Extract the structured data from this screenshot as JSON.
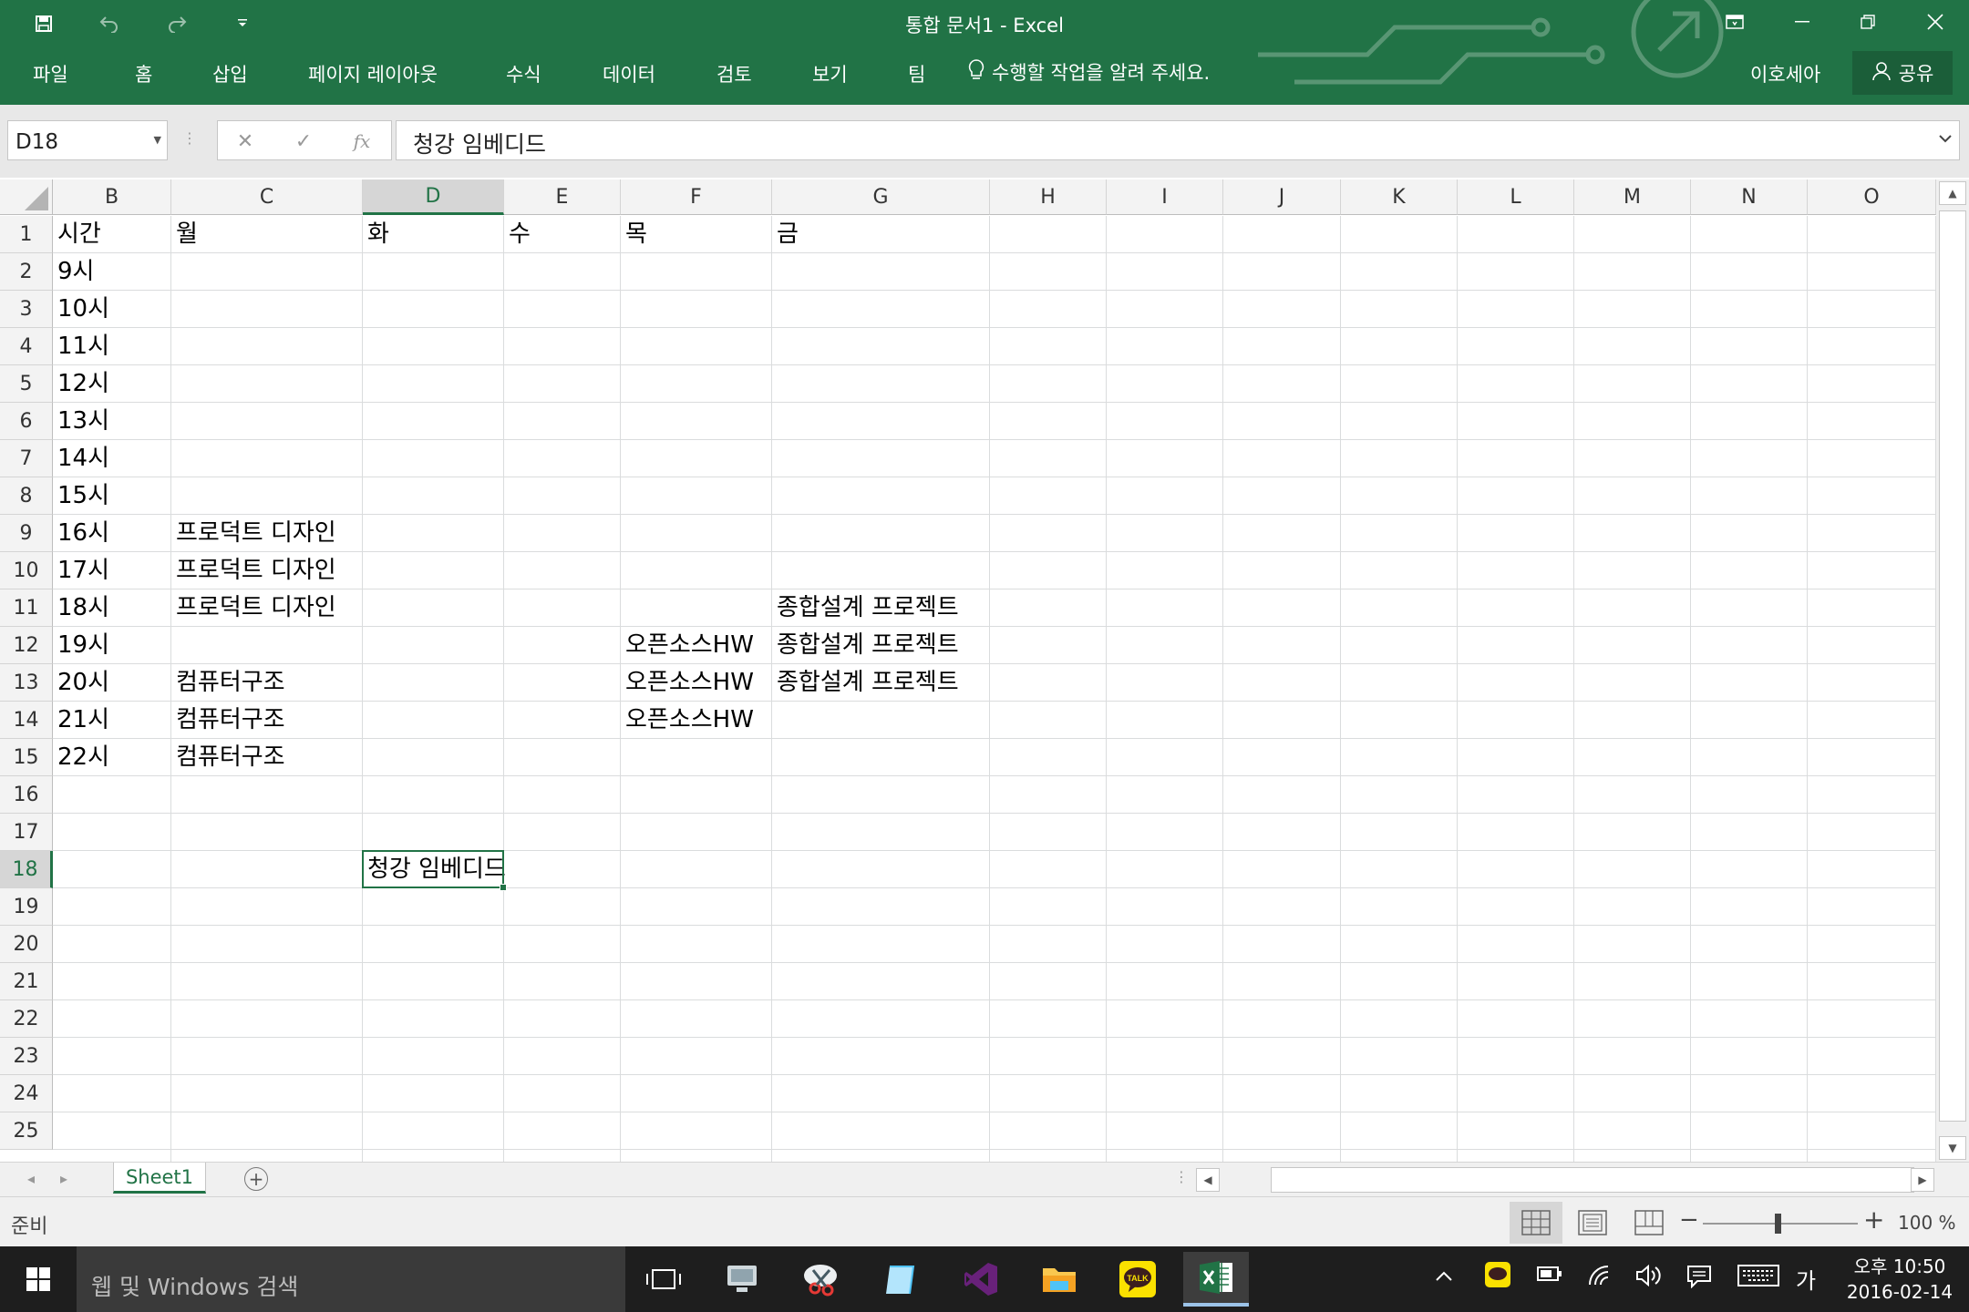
{
  "window": {
    "title": "통합 문서1 - Excel",
    "user_name": "이호세아",
    "share_label": "공유"
  },
  "ribbon": {
    "tabs": [
      "파일",
      "홈",
      "삽입",
      "페이지 레이아웃",
      "수식",
      "데이터",
      "검토",
      "보기",
      "팀"
    ],
    "tell_me": "수행할 작업을 알려 주세요."
  },
  "formula_bar": {
    "name_box": "D18",
    "fx_label": "fx",
    "content": "청강 임베디드"
  },
  "sheet": {
    "columns": [
      "B",
      "C",
      "D",
      "E",
      "F",
      "G",
      "H",
      "I",
      "J",
      "K",
      "L",
      "M",
      "N",
      "O"
    ],
    "active_column": "D",
    "rows": [
      "1",
      "2",
      "3",
      "4",
      "5",
      "6",
      "7",
      "8",
      "9",
      "10",
      "11",
      "12",
      "13",
      "14",
      "15",
      "16",
      "17",
      "18",
      "19",
      "20",
      "21",
      "22",
      "23",
      "24",
      "25"
    ],
    "active_row": "18",
    "cells": [
      {
        "ref": "B1",
        "value": "시간"
      },
      {
        "ref": "C1",
        "value": "월"
      },
      {
        "ref": "D1",
        "value": "화"
      },
      {
        "ref": "E1",
        "value": "수"
      },
      {
        "ref": "F1",
        "value": "목"
      },
      {
        "ref": "G1",
        "value": "금"
      },
      {
        "ref": "B2",
        "value": "9시"
      },
      {
        "ref": "B3",
        "value": "10시"
      },
      {
        "ref": "B4",
        "value": "11시"
      },
      {
        "ref": "B5",
        "value": "12시"
      },
      {
        "ref": "B6",
        "value": "13시"
      },
      {
        "ref": "B7",
        "value": "14시"
      },
      {
        "ref": "B8",
        "value": "15시"
      },
      {
        "ref": "B9",
        "value": "16시"
      },
      {
        "ref": "C9",
        "value": "프로덕트 디자인"
      },
      {
        "ref": "B10",
        "value": "17시"
      },
      {
        "ref": "C10",
        "value": "프로덕트 디자인"
      },
      {
        "ref": "B11",
        "value": "18시"
      },
      {
        "ref": "C11",
        "value": "프로덕트 디자인"
      },
      {
        "ref": "G11",
        "value": "종합설계 프로젝트"
      },
      {
        "ref": "B12",
        "value": "19시"
      },
      {
        "ref": "F12",
        "value": "오픈소스HW"
      },
      {
        "ref": "G12",
        "value": "종합설계 프로젝트"
      },
      {
        "ref": "B13",
        "value": "20시"
      },
      {
        "ref": "C13",
        "value": "컴퓨터구조"
      },
      {
        "ref": "F13",
        "value": "오픈소스HW"
      },
      {
        "ref": "G13",
        "value": "종합설계 프로젝트"
      },
      {
        "ref": "B14",
        "value": "21시"
      },
      {
        "ref": "C14",
        "value": "컴퓨터구조"
      },
      {
        "ref": "F14",
        "value": "오픈소스HW"
      },
      {
        "ref": "B15",
        "value": "22시"
      },
      {
        "ref": "C15",
        "value": "컴퓨터구조"
      },
      {
        "ref": "D18",
        "value": "청강 임베디드"
      }
    ],
    "tab_name": "Sheet1"
  },
  "status": {
    "ready": "준비",
    "zoom": "100 %"
  },
  "taskbar": {
    "search_placeholder": "웹 및 Windows 검색",
    "ime": "가",
    "time": "오후 10:50",
    "date": "2016-02-14",
    "kakao_label": "TALK",
    "apps": [
      "task-view",
      "remote-desktop",
      "snipping-tool",
      "notes",
      "visual-studio",
      "file-explorer",
      "kakaotalk",
      "excel"
    ]
  },
  "colors": {
    "excel_green": "#217346",
    "share_bg": "#1b5e39",
    "gridline": "#dadcdd",
    "header_bg": "#f3f3f3",
    "taskbar": "#1e1e1e"
  }
}
